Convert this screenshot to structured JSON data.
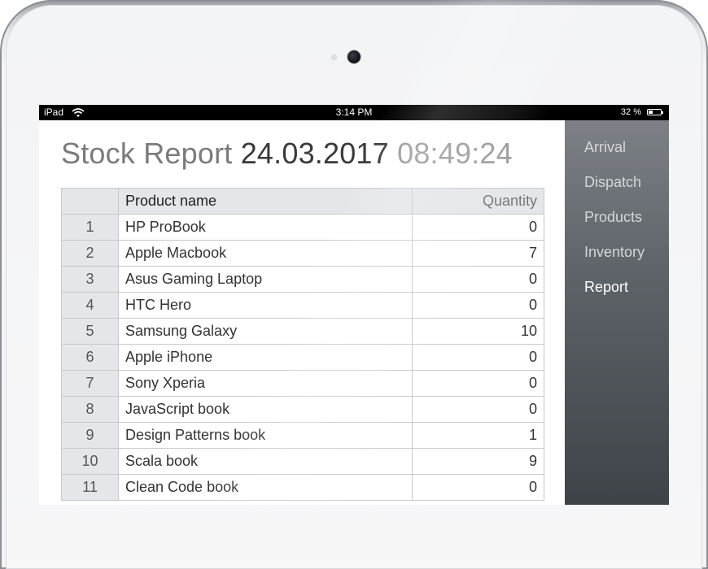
{
  "status_bar": {
    "carrier": "iPad",
    "time": "3:14 PM",
    "battery": "32 %"
  },
  "report": {
    "title": "Stock Report",
    "date": "24.03.2017",
    "time": "08:49:24",
    "columns": [
      "",
      "Product name",
      "Quantity"
    ],
    "rows": [
      {
        "num": "1",
        "name": "HP ProBook",
        "qty": "0"
      },
      {
        "num": "2",
        "name": "Apple Macbook",
        "qty": "7"
      },
      {
        "num": "3",
        "name": "Asus Gaming Laptop",
        "qty": "0"
      },
      {
        "num": "4",
        "name": "HTC Hero",
        "qty": "0"
      },
      {
        "num": "5",
        "name": "Samsung Galaxy",
        "qty": "10"
      },
      {
        "num": "6",
        "name": "Apple iPhone",
        "qty": "0"
      },
      {
        "num": "7",
        "name": "Sony Xperia",
        "qty": "0"
      },
      {
        "num": "8",
        "name": "JavaScript book",
        "qty": "0"
      },
      {
        "num": "9",
        "name": "Design Patterns book",
        "qty": "1"
      },
      {
        "num": "10",
        "name": "Scala book",
        "qty": "9"
      },
      {
        "num": "11",
        "name": "Clean Code book",
        "qty": "0"
      }
    ]
  },
  "sidebar": {
    "items": [
      {
        "label": "Arrival",
        "active": false
      },
      {
        "label": "Dispatch",
        "active": false
      },
      {
        "label": "Products",
        "active": false
      },
      {
        "label": "Inventory",
        "active": false
      },
      {
        "label": "Report",
        "active": true
      }
    ]
  },
  "icons": {
    "wifi": "wifi-icon",
    "battery": "battery-icon",
    "camera": "camera-icon"
  },
  "colors": {
    "sidebar_top": "#7d8186",
    "sidebar_bottom": "#3e4348",
    "header_bg": "#e4e6e9"
  }
}
